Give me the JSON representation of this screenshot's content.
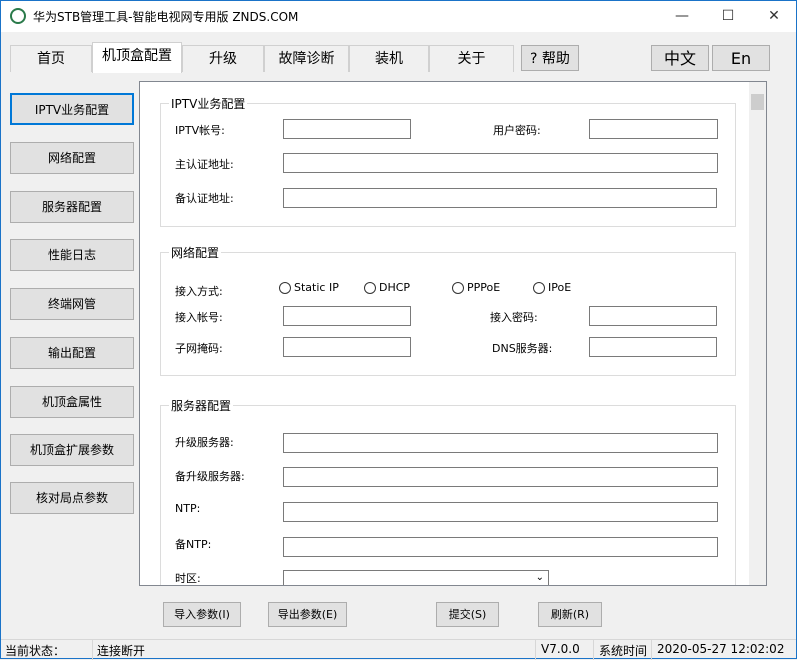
{
  "window": {
    "title": "华为STB管理工具-智能电视网专用版 ZNDS.COM",
    "minimize": "—",
    "maximize": "☐",
    "close": "✕"
  },
  "tabs": [
    "首页",
    "机顶盒配置",
    "升级",
    "故障诊断",
    "装机",
    "关于"
  ],
  "help": "? 帮助",
  "lang": [
    "中文",
    "En"
  ],
  "sidebar": [
    "IPTV业务配置",
    "网络配置",
    "服务器配置",
    "性能日志",
    "终端网管",
    "输出配置",
    "机顶盒属性",
    "机顶盒扩展参数",
    "核对局点参数"
  ],
  "iptv": {
    "title": "IPTV业务配置",
    "account": "IPTV帐号:",
    "password": "用户密码:",
    "main_auth": "主认证地址:",
    "backup_auth": "备认证地址:"
  },
  "network": {
    "title": "网络配置",
    "mode": "接入方式:",
    "options": [
      "Static IP",
      "DHCP",
      "PPPoE",
      "IPoE"
    ],
    "account": "接入帐号:",
    "password": "接入密码:",
    "mask": "子网掩码:",
    "dns": "DNS服务器:"
  },
  "server": {
    "title": "服务器配置",
    "upgrade": "升级服务器:",
    "backup_upgrade": "备升级服务器:",
    "ntp": "NTP:",
    "backup_ntp": "备NTP:",
    "timezone": "时区:"
  },
  "buttons": {
    "import": "导入参数(I)",
    "export": "导出参数(E)",
    "submit": "提交(S)",
    "refresh": "刷新(R)"
  },
  "status": {
    "label": "当前状态：",
    "value": "连接断开",
    "version": "V7.0.0",
    "time_label": "系统时间",
    "time": "2020-05-27 12:02:02"
  }
}
